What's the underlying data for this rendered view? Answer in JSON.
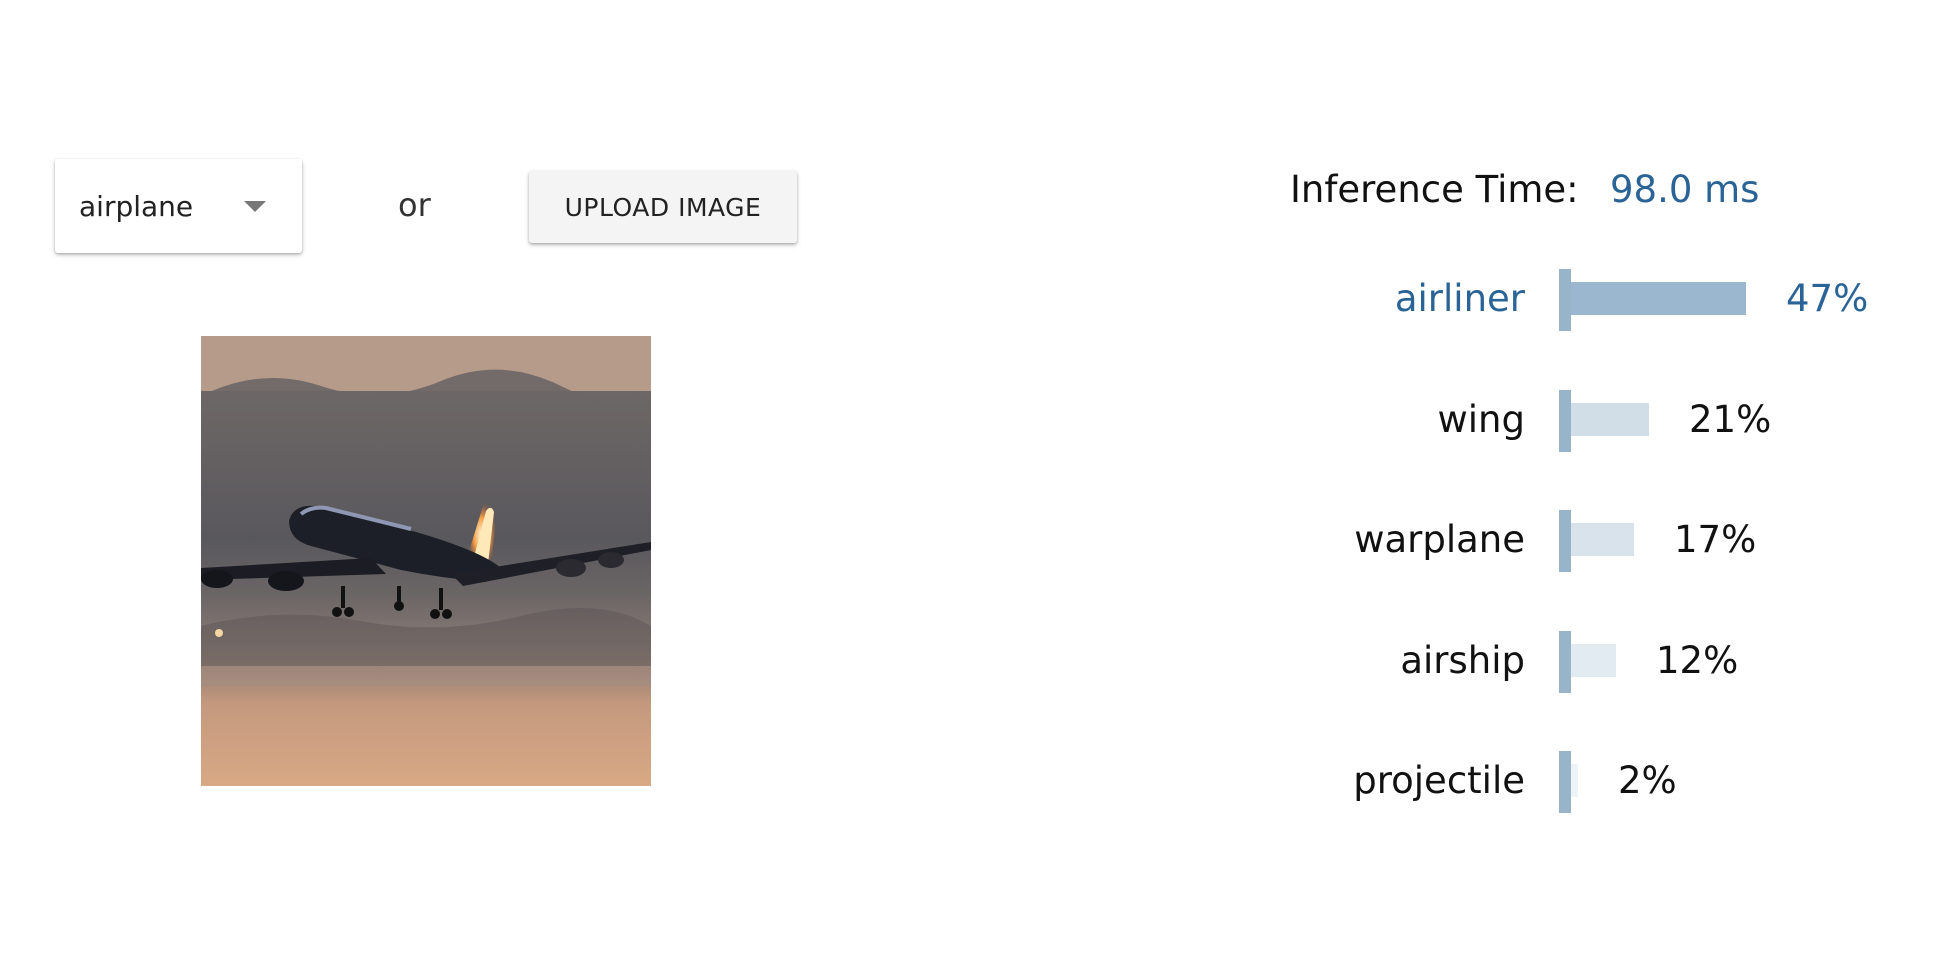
{
  "controls": {
    "select_value": "airplane",
    "or_text": "or",
    "upload_label": "UPLOAD IMAGE"
  },
  "results": {
    "inference_label": "Inference Time:",
    "inference_value": "98.0 ms",
    "predictions": [
      {
        "label": "airliner",
        "pct_text": "47%",
        "value": 0.47
      },
      {
        "label": "wing",
        "pct_text": "21%",
        "value": 0.21
      },
      {
        "label": "warplane",
        "pct_text": "17%",
        "value": 0.17
      },
      {
        "label": "airship",
        "pct_text": "12%",
        "value": 0.12
      },
      {
        "label": "projectile",
        "pct_text": "2%",
        "value": 0.02
      }
    ]
  },
  "colors": {
    "accent": "#2a6496",
    "bar_axis": "#97b4cb",
    "bar_fills": [
      "#9ab7cf",
      "#d1dde7",
      "#d8e3ec",
      "#e3ebf2",
      "#eef3f7"
    ]
  },
  "icons": {
    "dropdown": "caret-down-icon"
  }
}
